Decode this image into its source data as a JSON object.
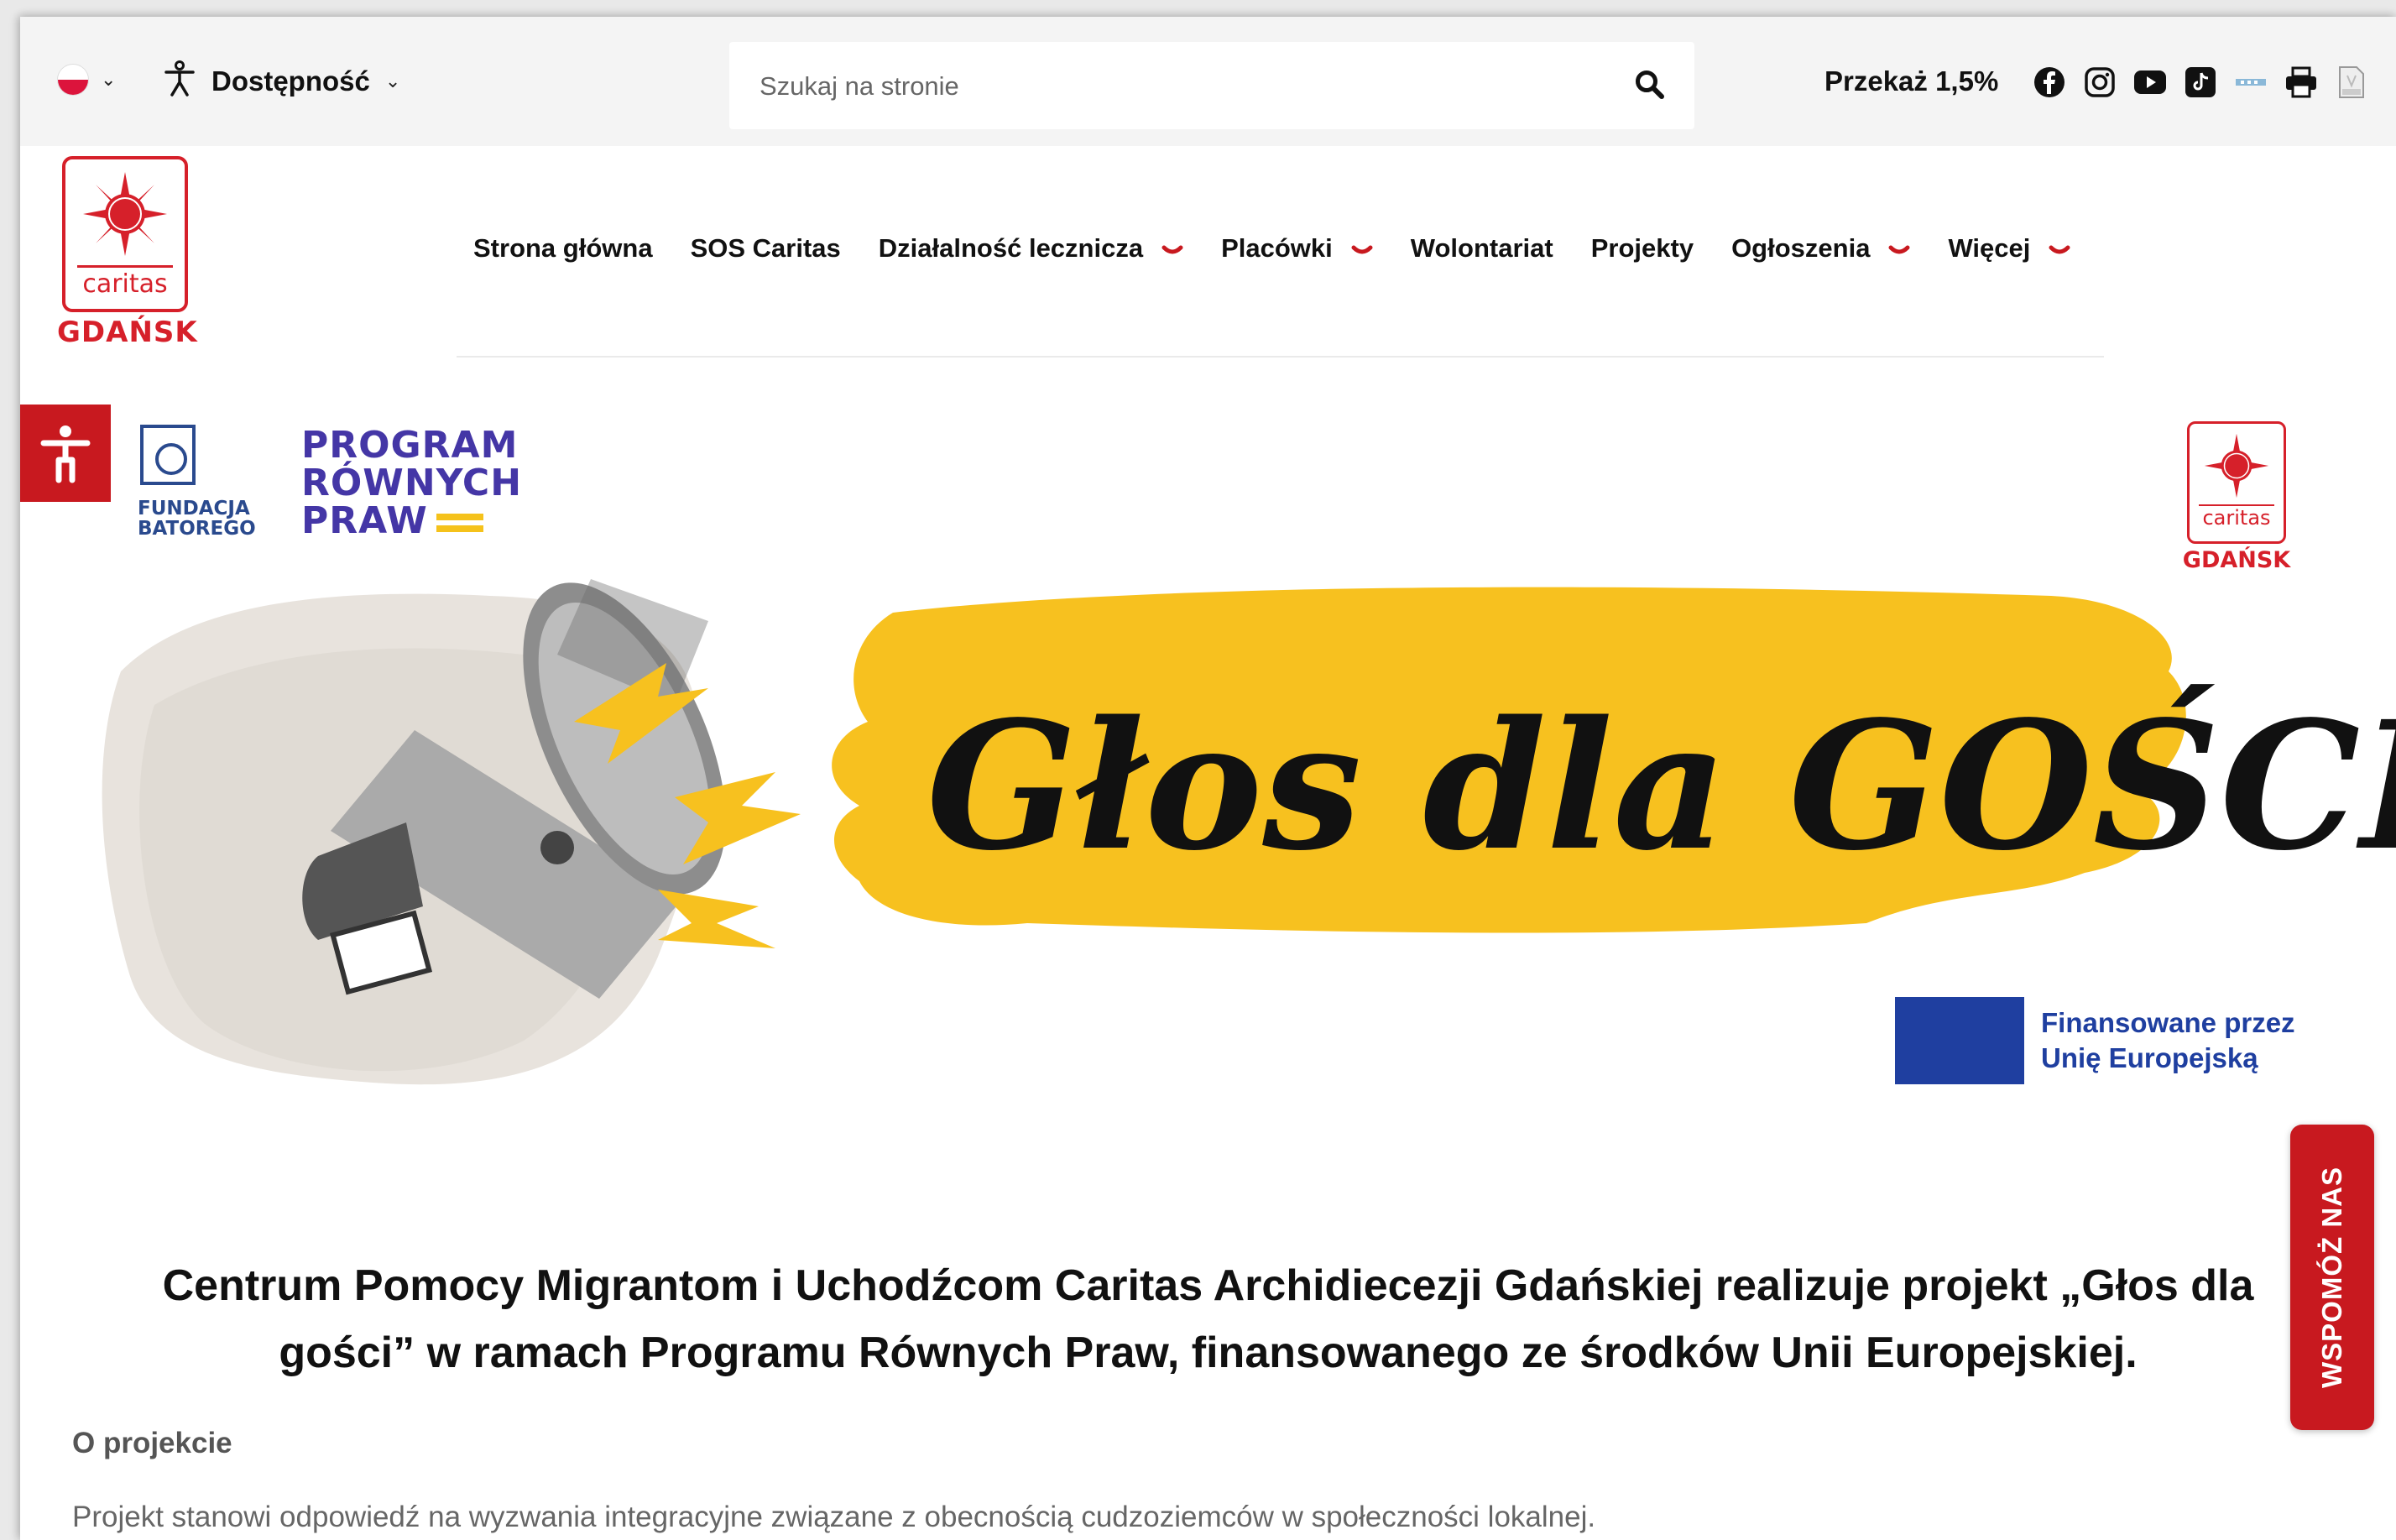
{
  "topbar": {
    "accessibility_label": "Dostępność",
    "search_placeholder": "Szukaj na stronie",
    "donate_label": "Przekaż 1,5%"
  },
  "logo": {
    "word": "caritas",
    "city": "GDAŃSK"
  },
  "nav": {
    "items": [
      {
        "label": "Strona główna"
      },
      {
        "label": "SOS Caritas"
      },
      {
        "label": "Działalność lecznicza"
      },
      {
        "label": "Placówki"
      },
      {
        "label": "Wolontariat"
      },
      {
        "label": "Projekty"
      },
      {
        "label": "Ogłoszenia"
      },
      {
        "label": "Więcej"
      }
    ]
  },
  "hero": {
    "batory_line1": "FUNDACJA",
    "batory_line2": "BATOREGO",
    "program_line1": "PROGRAM",
    "program_line2": "RÓWNYCH",
    "program_line3": "PRAW",
    "banner_title": "Głos dla GOŚCI",
    "logo2_word": "caritas",
    "logo2_city": "GDAŃSK",
    "eu_line1": "Finansowane przez",
    "eu_line2": "Unię Europejską"
  },
  "content": {
    "headline_line1": "Centrum Pomocy Migrantom i Uchodźcom Caritas Archidiecezji Gdańskiej realizuje projekt „Głos dla",
    "headline_line2": "gości” w ramach Programu Równych Praw, finansowanego ze środków Unii Europejskiej.",
    "section_title": "O projekcie",
    "paragraph": "Projekt stanowi odpowiedź na wyzwania integracyjne związane z obecnością cudzoziemców w społeczności lokalnej."
  },
  "help_tab": "WSPOMÓŻ NAS",
  "colors": {
    "brand_red": "#c8191f",
    "caritas_red": "#d6202a",
    "banner_yellow": "#f7c11f",
    "program_purple": "#4436a6",
    "eu_blue": "#1f3fa0"
  }
}
